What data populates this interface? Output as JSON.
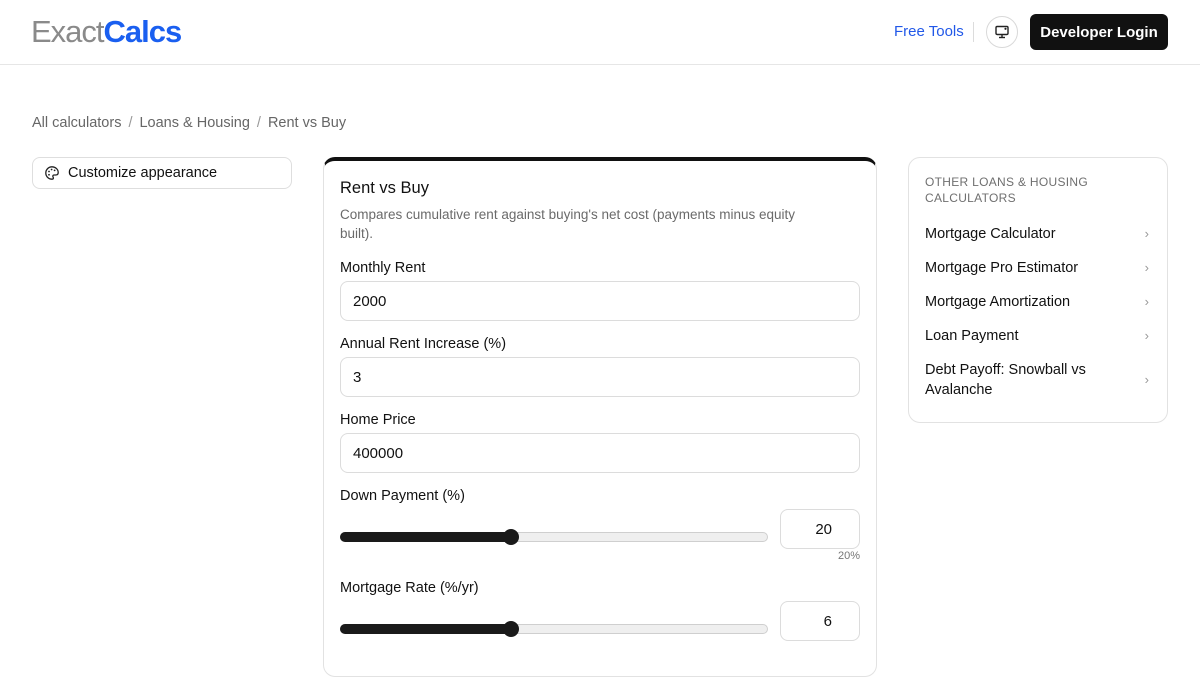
{
  "header": {
    "logo_light": "Exact",
    "logo_bold": "Calcs",
    "free_tools": "Free Tools",
    "theme_icon": "monitor-icon",
    "developer_login": "Developer Login",
    "brand_color": "#1a5ff0"
  },
  "breadcrumb": {
    "items": [
      "All calculators",
      "Loans & Housing",
      "Rent vs Buy"
    ],
    "separator": "/"
  },
  "customize": {
    "icon": "palette-icon",
    "label": "Customize appearance"
  },
  "calculator": {
    "title": "Rent vs Buy",
    "description": "Compares cumulative rent against buying's net cost (payments minus equity built).",
    "fields": {
      "monthly_rent": {
        "label": "Monthly Rent",
        "value": "2000"
      },
      "annual_rent_increase": {
        "label": "Annual Rent Increase (%)",
        "value": "3"
      },
      "home_price": {
        "label": "Home Price",
        "value": "400000"
      },
      "down_payment": {
        "label": "Down Payment (%)",
        "value": "20",
        "hint": "20%",
        "slider_fraction": 0.4
      },
      "mortgage_rate": {
        "label": "Mortgage Rate (%/yr)",
        "value": "6",
        "slider_fraction": 0.4
      }
    }
  },
  "sidebar": {
    "heading": "OTHER LOANS & HOUSING CALCULATORS",
    "items": [
      {
        "label": "Mortgage Calculator"
      },
      {
        "label": "Mortgage Pro Estimator"
      },
      {
        "label": "Mortgage Amortization"
      },
      {
        "label": "Loan Payment"
      },
      {
        "label": "Debt Payoff: Snowball vs Avalanche"
      }
    ],
    "chevron": "›"
  }
}
